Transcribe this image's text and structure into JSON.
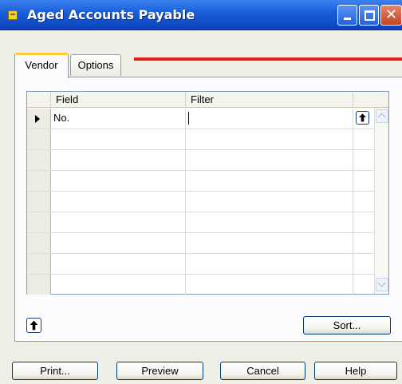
{
  "window": {
    "title": "Aged Accounts Payable",
    "controls": [
      "minimize-icon",
      "maximize-icon",
      "close-icon"
    ]
  },
  "tabs": [
    {
      "label": "Vendor",
      "active": true
    },
    {
      "label": "Options",
      "active": false
    }
  ],
  "grid": {
    "columns": [
      "Field",
      "Filter"
    ],
    "rows": [
      {
        "field": "No.",
        "filter": "",
        "current": true
      },
      {
        "field": "",
        "filter": ""
      },
      {
        "field": "",
        "filter": ""
      },
      {
        "field": "",
        "filter": ""
      },
      {
        "field": "",
        "filter": ""
      },
      {
        "field": "",
        "filter": ""
      },
      {
        "field": "",
        "filter": ""
      },
      {
        "field": "",
        "filter": ""
      },
      {
        "field": "",
        "filter": ""
      }
    ]
  },
  "buttons": {
    "sort": {
      "label": "Sort...",
      "mnemonic": "S"
    },
    "print": {
      "label": "Print...",
      "mnemonic": "P"
    },
    "preview": {
      "label": "Preview",
      "mnemonic": "v"
    },
    "cancel": {
      "label": "Cancel"
    },
    "help": {
      "label": "Help"
    }
  },
  "colors": {
    "titlebar": "#1c5fd8",
    "active_tab_accent": "#ffc83c",
    "annotation_line": "#e2201a"
  }
}
